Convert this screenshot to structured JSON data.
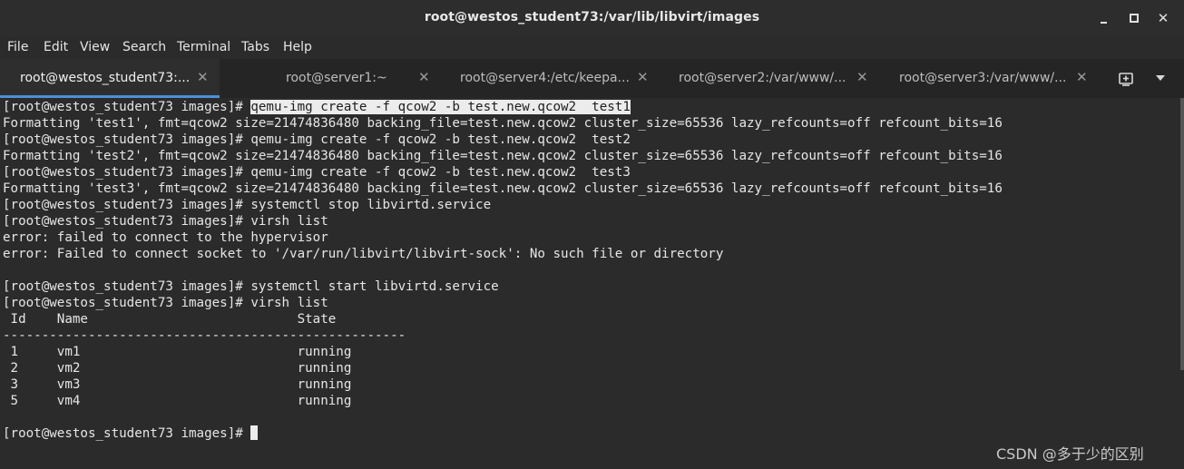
{
  "window": {
    "title": "root@westos_student73:/var/lib/libvirt/images"
  },
  "menu": [
    "File",
    "Edit",
    "View",
    "Search",
    "Terminal",
    "Tabs",
    "Help"
  ],
  "tabs": [
    {
      "label": "root@westos_student73:...",
      "active": true
    },
    {
      "label": "root@server1:~",
      "active": false
    },
    {
      "label": "root@server4:/etc/keepa...",
      "active": false
    },
    {
      "label": "root@server2:/var/www/...",
      "active": false
    },
    {
      "label": "root@server3:/var/www/...",
      "active": false
    }
  ],
  "terminal": {
    "prompt": "[root@westos_student73 images]# ",
    "selected_command": "qemu-img create -f qcow2 -b test.new.qcow2  test1",
    "lines": [
      "Formatting 'test1', fmt=qcow2 size=21474836480 backing_file=test.new.qcow2 cluster_size=65536 lazy_refcounts=off refcount_bits=16",
      "[root@westos_student73 images]# qemu-img create -f qcow2 -b test.new.qcow2  test2",
      "Formatting 'test2', fmt=qcow2 size=21474836480 backing_file=test.new.qcow2 cluster_size=65536 lazy_refcounts=off refcount_bits=16",
      "[root@westos_student73 images]# qemu-img create -f qcow2 -b test.new.qcow2  test3",
      "Formatting 'test3', fmt=qcow2 size=21474836480 backing_file=test.new.qcow2 cluster_size=65536 lazy_refcounts=off refcount_bits=16",
      "[root@westos_student73 images]# systemctl stop libvirtd.service",
      "[root@westos_student73 images]# virsh list",
      "error: failed to connect to the hypervisor",
      "error: Failed to connect socket to '/var/run/libvirt/libvirt-sock': No such file or directory",
      "",
      "[root@westos_student73 images]# systemctl start libvirtd.service",
      "[root@westos_student73 images]# virsh list",
      " Id    Name                           State",
      "----------------------------------------------------",
      " 1     vm1                            running",
      " 2     vm2                            running",
      " 3     vm3                            running",
      " 5     vm4                            running",
      ""
    ],
    "last_prompt": "[root@westos_student73 images]# "
  },
  "watermark": "CSDN @多于少的区别"
}
